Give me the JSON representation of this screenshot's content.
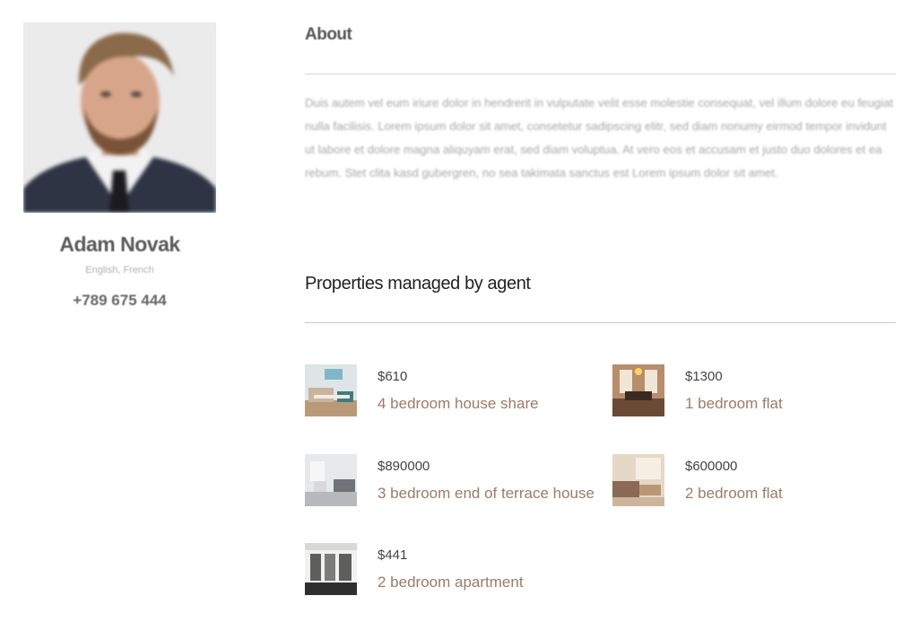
{
  "agent": {
    "name": "Adam Novak",
    "languages": "English, French",
    "phone": "+789 675 444"
  },
  "about": {
    "heading": "About",
    "text": "Duis autem vel eum iriure dolor in hendrerit in vulputate velit esse molestie consequat, vel illum dolore eu feugiat nulla facilisis. Lorem ipsum dolor sit amet, consetetur sadipscing elitr, sed diam nonumy eirmod tempor invidunt ut labore et dolore magna aliquyam erat, sed diam voluptua. At vero eos et accusam et justo duo dolores et ea rebum. Stet clita kasd gubergren, no sea takimata sanctus est Lorem ipsum dolor sit amet."
  },
  "properties": {
    "heading": "Properties managed by agent",
    "items": [
      {
        "price": "$610",
        "title": "4 bedroom house share"
      },
      {
        "price": "$1300",
        "title": "1 bedroom flat"
      },
      {
        "price": "$890000",
        "title": "3 bedroom end of terrace house"
      },
      {
        "price": "$600000",
        "title": "2 bedroom flat"
      },
      {
        "price": "$441",
        "title": "2 bedroom apartment"
      }
    ]
  },
  "colors": {
    "link": "#9c7b68",
    "rule": "#d7d7d7"
  }
}
